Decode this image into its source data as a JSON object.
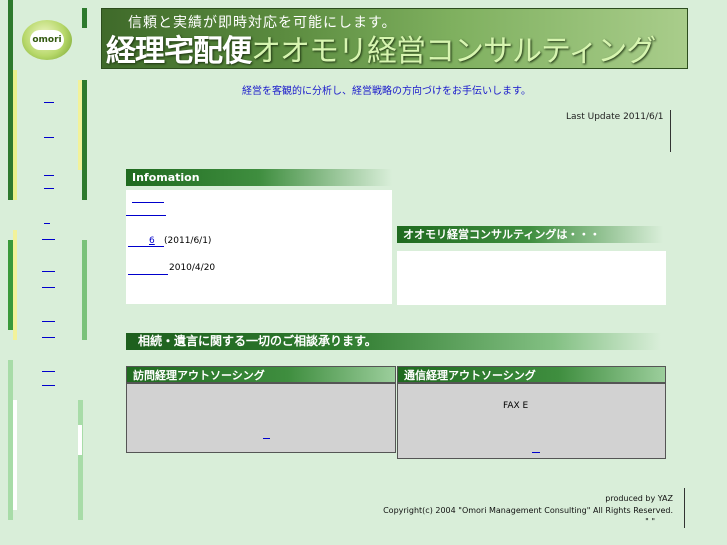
{
  "logo_text": "omori",
  "banner": {
    "subtitle": "信頼と実績が即時対応を可能にします。",
    "title_main": "経理宅配便",
    "title_company": "オオモリ経営コンサルティング"
  },
  "tagline": "経営を客観的に分析し、経営戦略の方向づけをお手伝いします。",
  "last_update": "Last Update 2011/6/1",
  "information": {
    "header": "Infomation",
    "items": [
      {
        "date": "(2011/6/1)",
        "prefix": "6"
      },
      {
        "date": "2010/4/20"
      }
    ]
  },
  "about": {
    "header": "オオモリ経営コンサルティングは・・・"
  },
  "consult_banner": "相続・遺言に関する一切のご相談承ります。",
  "visit": {
    "header": "訪問経理アウトソーシング"
  },
  "remote": {
    "header": "通信経理アウトソーシング",
    "fax_label": "FAX E"
  },
  "footer": {
    "produced": "produced by YAZ",
    "copyright": "Copyright(c) 2004 \"Omori Management Consulting\" All Rights Reserved.",
    "quote": "\"                    \""
  }
}
